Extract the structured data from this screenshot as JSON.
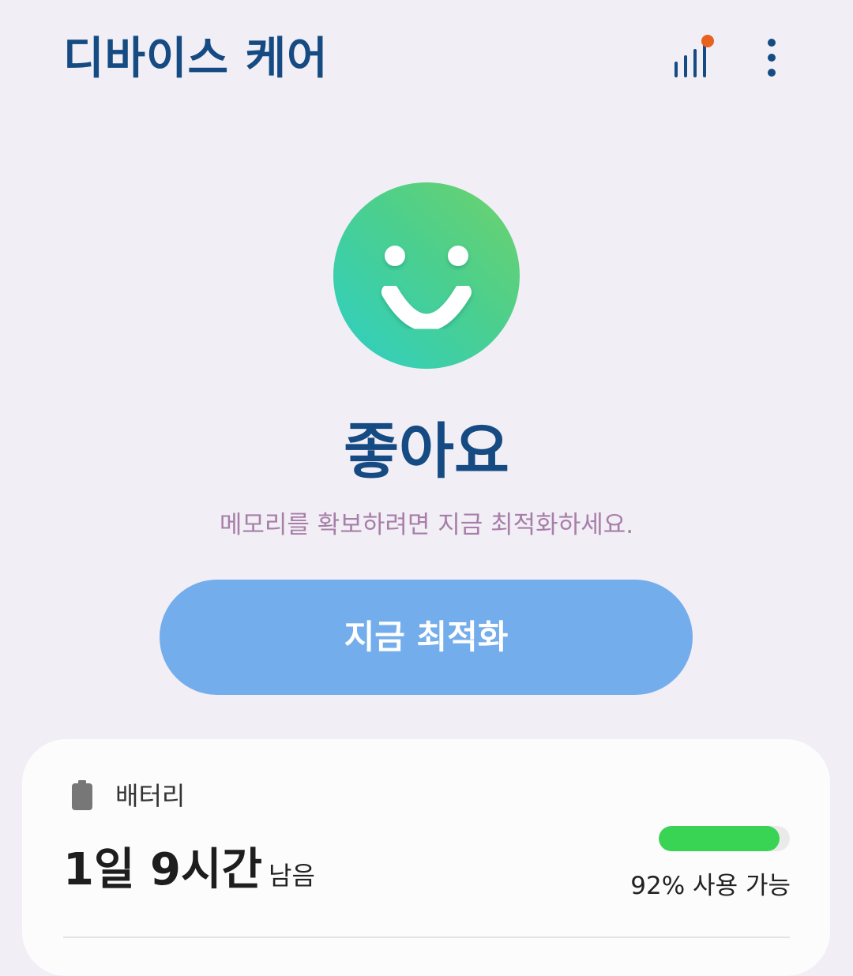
{
  "header": {
    "title": "디바이스 케어",
    "signal_icon": "signal-bars-icon",
    "more_icon": "more-vertical-icon"
  },
  "status": {
    "icon": "smiley-face-icon",
    "title": "좋아요",
    "subtitle": "메모리를 확보하려면 지금 최적화하세요."
  },
  "actions": {
    "optimize_label": "지금 최적화"
  },
  "battery": {
    "icon": "battery-icon",
    "label": "배터리",
    "time_main": "1일 9시간",
    "time_suffix": "남음",
    "percent_text": "92% 사용 가능",
    "level_percent": 92
  },
  "colors": {
    "title": "#154a82",
    "subtitle": "#a77ea8",
    "button": "#74adec",
    "battery_bar": "#3ad454",
    "notification_dot": "#e8621f"
  }
}
